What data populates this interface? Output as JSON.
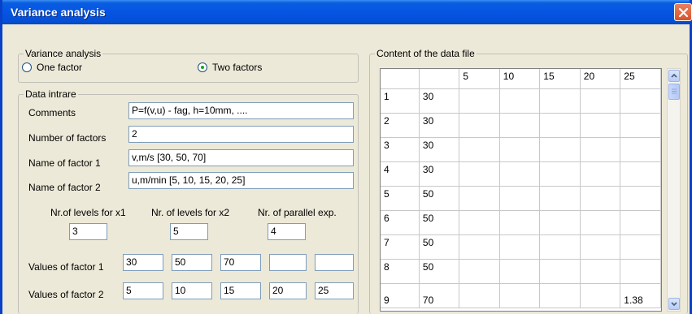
{
  "window": {
    "title": "Variance analysis"
  },
  "variance_group": {
    "legend": "Variance analysis",
    "options": [
      {
        "label": "One factor",
        "checked": false
      },
      {
        "label": "Two factors",
        "checked": true
      }
    ]
  },
  "data_group": {
    "legend": "Data intrare",
    "comments_label": "Comments",
    "comments_value": "P=f(v,u) - fag, h=10mm, ....",
    "num_factors_label": "Number of factors",
    "num_factors_value": "2",
    "factor1_name_label": "Name of factor 1",
    "factor1_name_value": "v,m/s [30, 50, 70]",
    "factor2_name_label": "Name of factor 2",
    "factor2_name_value": "u,m/min [5, 10, 15, 20, 25]",
    "levels_x1_label": "Nr.of levels for x1",
    "levels_x1_value": "3",
    "levels_x2_label": "Nr. of levels for x2",
    "levels_x2_value": "5",
    "parallel_label": "Nr. of parallel exp.",
    "parallel_value": "4",
    "values_f1_label": "Values of factor 1",
    "values_f1": [
      "30",
      "50",
      "70",
      "",
      ""
    ],
    "values_f2_label": "Values of factor 2",
    "values_f2": [
      "5",
      "10",
      "15",
      "20",
      "25"
    ]
  },
  "content_group": {
    "legend": "Content of the data file",
    "header": [
      "",
      "",
      "5",
      "10",
      "15",
      "20",
      "25"
    ],
    "rows": [
      [
        "1",
        "30",
        "",
        "",
        "",
        "",
        ""
      ],
      [
        "2",
        "30",
        "",
        "",
        "",
        "",
        ""
      ],
      [
        "3",
        "30",
        "",
        "",
        "",
        "",
        ""
      ],
      [
        "4",
        "30",
        "",
        "",
        "",
        "",
        ""
      ],
      [
        "5",
        "50",
        "",
        "",
        "",
        "",
        ""
      ],
      [
        "6",
        "50",
        "",
        "",
        "",
        "",
        ""
      ],
      [
        "7",
        "50",
        "",
        "",
        "",
        "",
        ""
      ],
      [
        "8",
        "50",
        "",
        "",
        "",
        "",
        ""
      ],
      [
        "9",
        "70",
        "",
        "",
        "",
        "",
        "1.38"
      ]
    ]
  },
  "icons": {
    "close": "close-icon",
    "scroll_up": "arrow-up-icon",
    "scroll_down": "arrow-down-icon"
  }
}
